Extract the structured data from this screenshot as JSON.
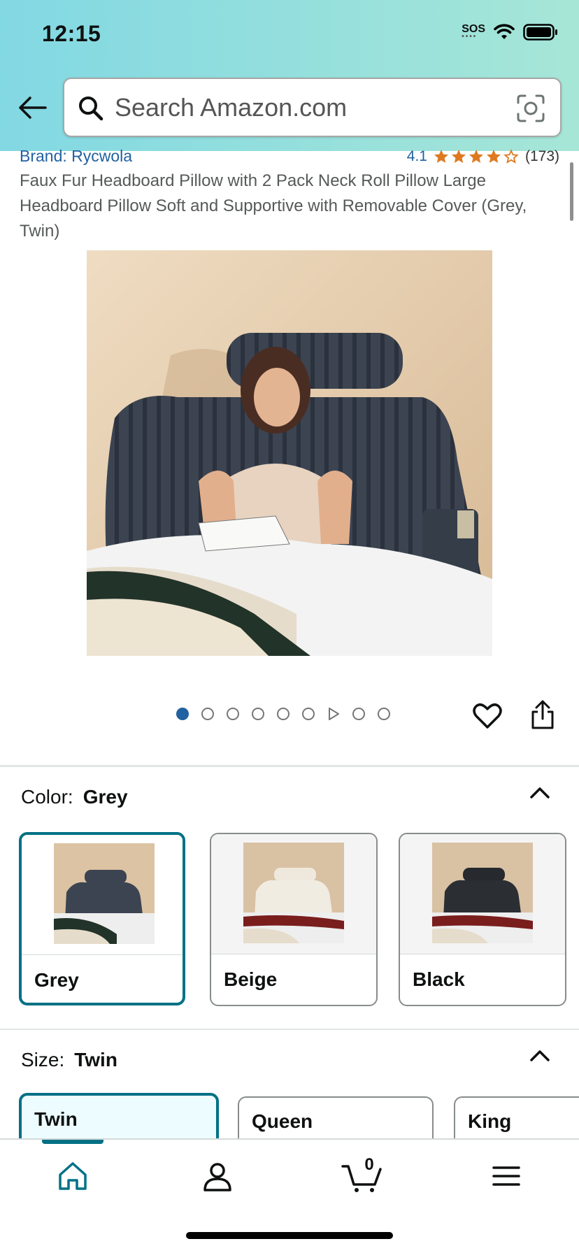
{
  "status_bar": {
    "time": "12:15",
    "sos": "SOS"
  },
  "search": {
    "placeholder": "Search Amazon.com"
  },
  "product": {
    "brand": "Brand: Rycwola",
    "rating_value": "4.1",
    "rating_count": "(173)",
    "stars_filled": 4,
    "stars_total": 5,
    "title": "Faux Fur Headboard Pillow with 2 Pack Neck Roll Pillow Large Headboard Pillow Soft and Supportive with Removable Cover (Grey, Twin)"
  },
  "carousel": {
    "total": 9,
    "active_index": 0,
    "video_index": 6
  },
  "color": {
    "label": "Color:",
    "selected": "Grey",
    "options": [
      {
        "label": "Grey",
        "selected": true
      },
      {
        "label": "Beige",
        "selected": false
      },
      {
        "label": "Black",
        "selected": false
      }
    ]
  },
  "size": {
    "label": "Size:",
    "selected": "Twin",
    "options": [
      {
        "label": "Twin",
        "selected": true
      },
      {
        "label": "Queen",
        "selected": false
      },
      {
        "label": "King",
        "selected": false
      }
    ]
  },
  "nav": {
    "cart_count": "0"
  },
  "colors": {
    "link": "#2162a1",
    "star": "#de7921",
    "accent": "#007185"
  }
}
